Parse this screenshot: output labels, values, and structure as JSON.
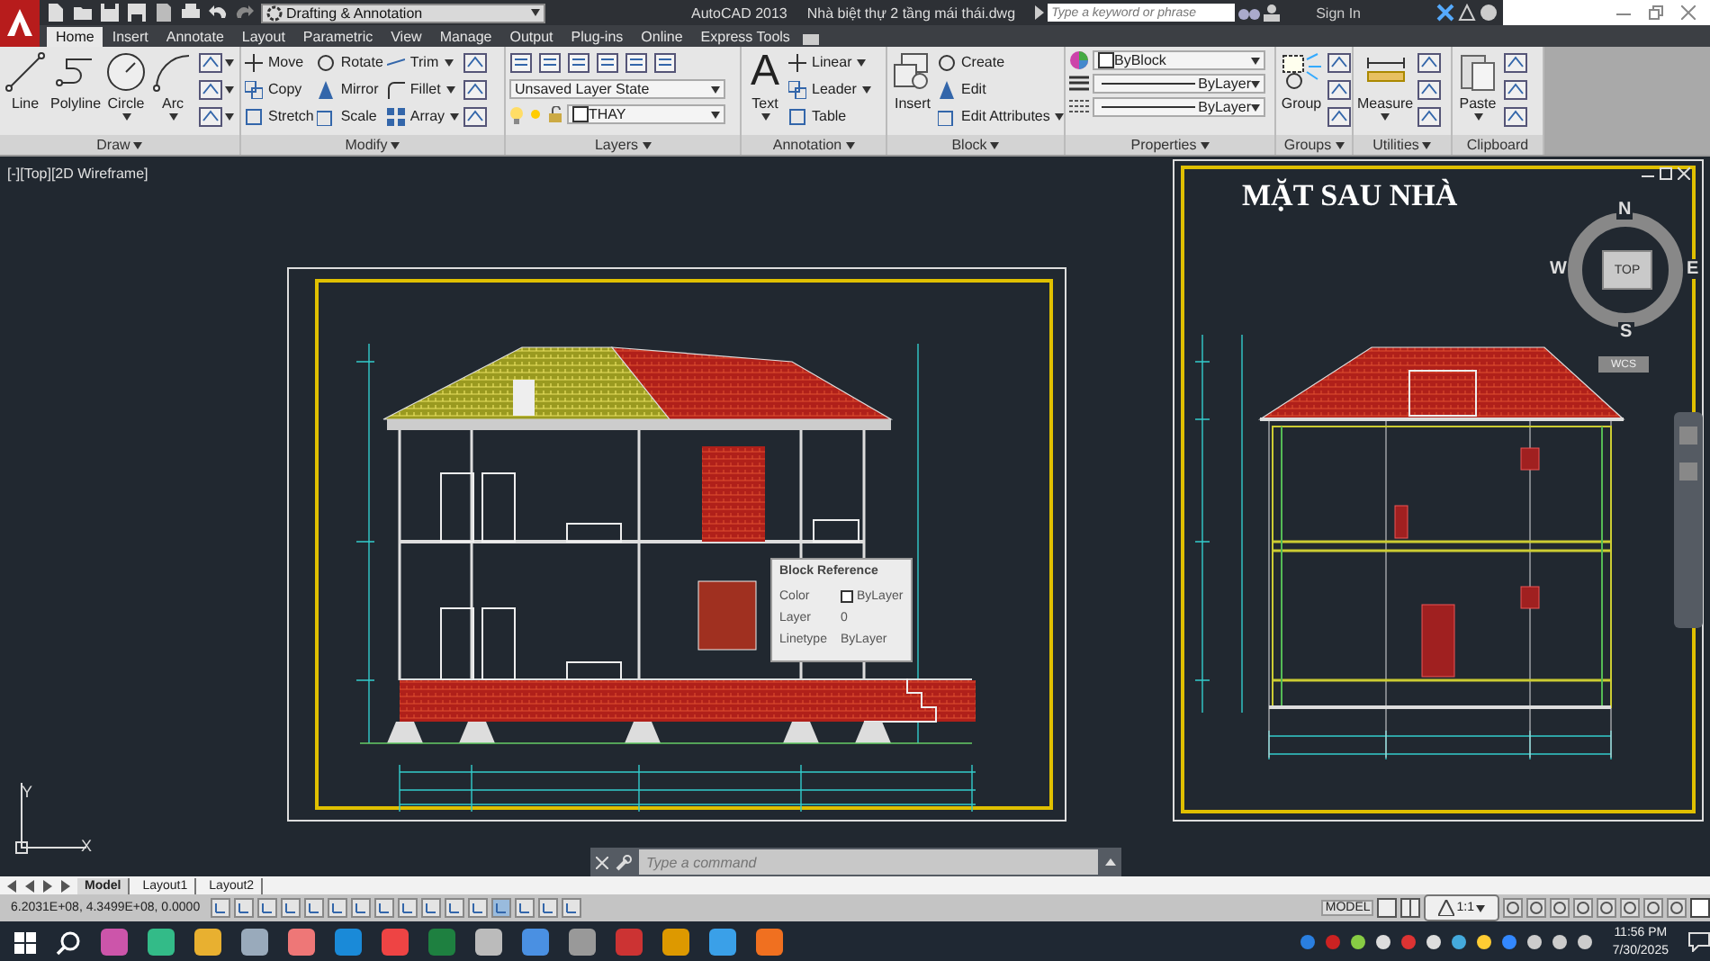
{
  "app": {
    "workspace": "Drafting & Annotation",
    "title": "AutoCAD 2013",
    "file": "Nhà biệt thự 2 tầng mái thái.dwg",
    "search": {
      "placeholder": "Type a keyword or phrase"
    },
    "sign_in": "Sign In"
  },
  "tabs": [
    {
      "label": "Home",
      "selected": true
    },
    {
      "label": "Insert",
      "selected": false
    },
    {
      "label": "Annotate",
      "selected": false
    },
    {
      "label": "Layout",
      "selected": false
    },
    {
      "label": "Parametric",
      "selected": false
    },
    {
      "label": "View",
      "selected": false
    },
    {
      "label": "Manage",
      "selected": false
    },
    {
      "label": "Output",
      "selected": false
    },
    {
      "label": "Plug-ins",
      "selected": false
    },
    {
      "label": "Online",
      "selected": false
    },
    {
      "label": "Express Tools",
      "selected": false
    }
  ],
  "panels": [
    {
      "title": "Draw",
      "menu": true,
      "columns": [
        [
          {
            "kind": "large",
            "label": "Line",
            "menu": false
          }
        ],
        [
          {
            "kind": "large",
            "label": "Polyline",
            "menu": false
          }
        ],
        [
          {
            "kind": "large",
            "label": "Circle",
            "menu": true
          }
        ],
        [
          {
            "kind": "large",
            "label": "Arc",
            "menu": true
          }
        ],
        [
          {
            "kind": "icon",
            "menu": true
          },
          {
            "kind": "icon",
            "menu": true
          },
          {
            "kind": "icon",
            "menu": true
          }
        ]
      ]
    },
    {
      "title": "Modify",
      "menu": true,
      "columns": [
        [
          {
            "kind": "small",
            "label": "Move",
            "menu": false
          },
          {
            "kind": "small",
            "label": "Copy",
            "menu": false
          },
          {
            "kind": "small",
            "label": "Stretch",
            "menu": false
          }
        ],
        [
          {
            "kind": "small",
            "label": "Rotate",
            "menu": false
          },
          {
            "kind": "small",
            "label": "Mirror",
            "menu": false
          },
          {
            "kind": "small",
            "label": "Scale",
            "menu": false
          }
        ],
        [
          {
            "kind": "small",
            "label": "Trim",
            "menu": true
          },
          {
            "kind": "small",
            "label": "Fillet",
            "menu": true
          },
          {
            "kind": "small",
            "label": "Array",
            "menu": true
          }
        ],
        [
          {
            "kind": "icon",
            "menu": false
          },
          {
            "kind": "icon",
            "menu": false
          },
          {
            "kind": "icon",
            "menu": false
          }
        ]
      ]
    },
    {
      "title": "Layers",
      "menu": true,
      "columns": [
        [
          {
            "kind": "icons"
          },
          {
            "kind": "combo",
            "value": "Unsaved Layer State"
          },
          {
            "kind": "layer",
            "value": "THAY"
          }
        ]
      ]
    },
    {
      "title": "Annotation",
      "menu": true,
      "columns": [
        [
          {
            "kind": "large",
            "label": "Text",
            "icon": "A",
            "menu": true
          }
        ],
        [
          {
            "kind": "small",
            "label": "Linear",
            "menu": true
          },
          {
            "kind": "small",
            "label": "Leader",
            "menu": true
          },
          {
            "kind": "small",
            "label": "Table",
            "menu": false
          }
        ]
      ]
    },
    {
      "title": "Block",
      "menu": true,
      "columns": [
        [
          {
            "kind": "large",
            "label": "Insert",
            "menu": false
          }
        ],
        [
          {
            "kind": "small",
            "label": "Create",
            "menu": false
          },
          {
            "kind": "small",
            "label": "Edit",
            "menu": false
          },
          {
            "kind": "small",
            "label": "Edit Attributes",
            "menu": true
          }
        ]
      ]
    },
    {
      "title": "Properties",
      "menu": true,
      "columns": [
        [
          {
            "kind": "prop",
            "value": "ByBlock"
          },
          {
            "kind": "prop",
            "value": "ByLayer"
          },
          {
            "kind": "prop",
            "value": "ByLayer"
          }
        ]
      ]
    },
    {
      "title": "Groups",
      "menu": true,
      "columns": [
        [
          {
            "kind": "large",
            "label": "Group",
            "menu": false
          }
        ],
        [
          {
            "kind": "icon",
            "menu": false
          },
          {
            "kind": "icon",
            "menu": false
          },
          {
            "kind": "icon",
            "menu": false
          }
        ]
      ]
    },
    {
      "title": "Utilities",
      "menu": true,
      "columns": [
        [
          {
            "kind": "large",
            "label": "Measure",
            "menu": true
          }
        ],
        [
          {
            "kind": "icon",
            "menu": false
          },
          {
            "kind": "icon",
            "menu": false
          },
          {
            "kind": "icon",
            "menu": false
          }
        ]
      ]
    },
    {
      "title": "Clipboard",
      "menu": false,
      "columns": [
        [
          {
            "kind": "large",
            "label": "Paste",
            "menu": true
          }
        ],
        [
          {
            "kind": "icon",
            "menu": false
          },
          {
            "kind": "icon",
            "menu": false
          },
          {
            "kind": "icon",
            "menu": false
          }
        ]
      ]
    }
  ],
  "viewport": {
    "label": "[-][Top][2D Wireframe]",
    "sheet_title": "MẶT SAU NHÀ"
  },
  "viewcube": {
    "north": "N",
    "south": "S",
    "west": "W",
    "east": "E",
    "face": "TOP",
    "ucs": "WCS"
  },
  "tooltip": {
    "title": "Block Reference",
    "rows": [
      {
        "kind": "color",
        "label": "Color",
        "value": "ByLayer"
      },
      {
        "kind": "text",
        "label": "Layer",
        "value": "0"
      },
      {
        "kind": "text",
        "label": "Linetype",
        "value": "ByLayer"
      }
    ]
  },
  "ucs": {
    "x": "X",
    "y": "Y"
  },
  "command": {
    "placeholder": "Type a command"
  },
  "layout_tabs": [
    {
      "label": "Model",
      "selected": true
    },
    {
      "label": "Layout1",
      "selected": false
    },
    {
      "label": "Layout2",
      "selected": false
    }
  ],
  "status_bar": {
    "coordinates": "6.2031E+08, 4.3499E+08, 0.0000",
    "space": "MODEL",
    "scale": "1:1"
  },
  "taskbar": {
    "time": "11:56 PM",
    "date": "7/30/2025"
  }
}
